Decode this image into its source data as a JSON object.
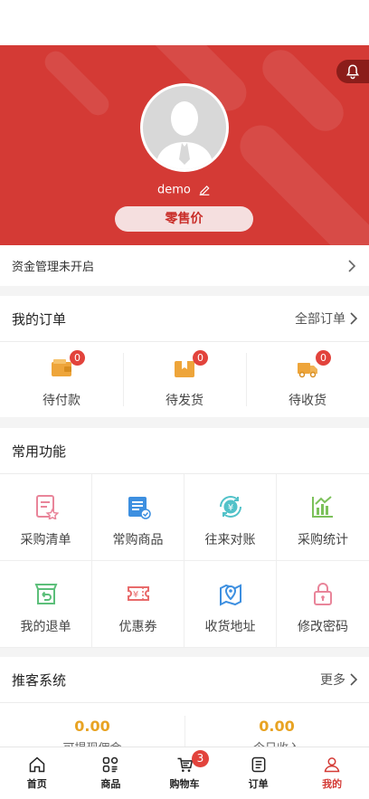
{
  "colors": {
    "brand": "#d43a35",
    "accent": "#e8a323",
    "badge": "#e2433c"
  },
  "profile": {
    "username": "demo",
    "role": "零售价"
  },
  "fund": {
    "label": "资金管理未开启"
  },
  "orders": {
    "title": "我的订单",
    "more": "全部订单",
    "items": [
      {
        "label": "待付款",
        "count": "0",
        "icon": "wallet-icon"
      },
      {
        "label": "待发货",
        "count": "0",
        "icon": "package-icon"
      },
      {
        "label": "待收货",
        "count": "0",
        "icon": "truck-icon"
      }
    ]
  },
  "functions": {
    "title": "常用功能",
    "items": [
      {
        "label": "采购清单",
        "icon": "purchase-list-icon"
      },
      {
        "label": "常购商品",
        "icon": "frequent-goods-icon"
      },
      {
        "label": "往来对账",
        "icon": "reconcile-icon"
      },
      {
        "label": "采购统计",
        "icon": "statistics-icon"
      },
      {
        "label": "我的退单",
        "icon": "return-box-icon"
      },
      {
        "label": "优惠券",
        "icon": "coupon-icon"
      },
      {
        "label": "收货地址",
        "icon": "map-pin-icon"
      },
      {
        "label": "修改密码",
        "icon": "lock-icon"
      }
    ]
  },
  "promoter": {
    "title": "推客系统",
    "more": "更多",
    "items": [
      {
        "value": "0.00",
        "label": "可提现佣金"
      },
      {
        "value": "0.00",
        "label": "今日收入"
      }
    ]
  },
  "tabbar": {
    "items": [
      {
        "label": "首页",
        "icon": "home-icon"
      },
      {
        "label": "商品",
        "icon": "grid-icon"
      },
      {
        "label": "购物车",
        "icon": "cart-icon",
        "badge": "3"
      },
      {
        "label": "订单",
        "icon": "order-list-icon"
      },
      {
        "label": "我的",
        "icon": "user-icon",
        "active": true
      }
    ]
  }
}
